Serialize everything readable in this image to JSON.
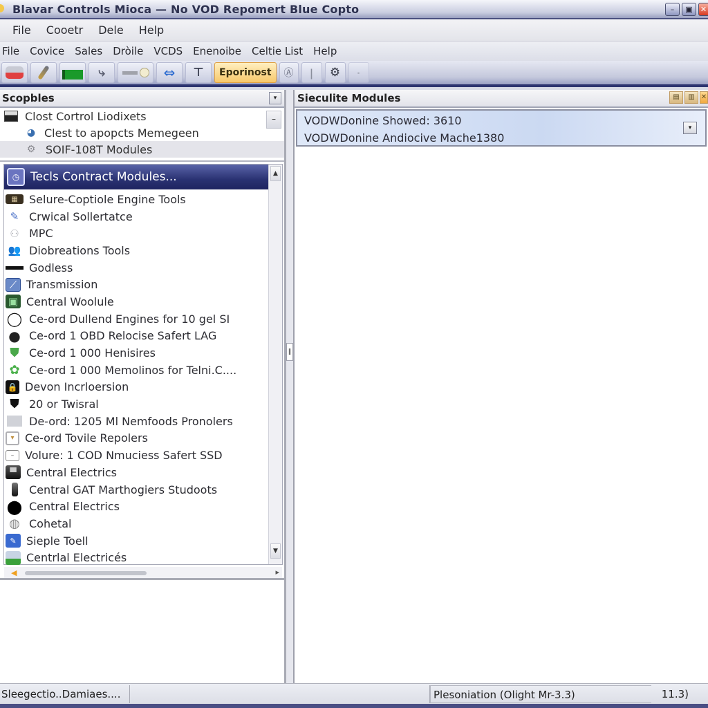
{
  "window": {
    "title": "Blavar Controls Mioca — No VOD Repomert Blue Copto",
    "controls": {
      "minimize": "–",
      "maximize": "▣",
      "close": "✕"
    }
  },
  "menubar_primary": [
    {
      "label": "File",
      "icon": null
    },
    {
      "label": "Cooetr"
    },
    {
      "label": "Dele"
    },
    {
      "label": "Help"
    }
  ],
  "menubar_secondary": [
    {
      "label": "File"
    },
    {
      "label": "Covice"
    },
    {
      "label": "Sales"
    },
    {
      "label": "Dròile"
    },
    {
      "label": "VCDS"
    },
    {
      "label": "Enenoibe"
    },
    {
      "label": "Celtie List"
    },
    {
      "label": "Help"
    }
  ],
  "toolbar": {
    "buttons": [
      {
        "icon": "connect-icon",
        "glyph": "🔌"
      },
      {
        "icon": "probe-icon",
        "glyph": "🖊"
      },
      {
        "icon": "battery-icon",
        "glyph": "▬"
      },
      {
        "icon": "wrench-icon",
        "glyph": "ℹ"
      },
      {
        "icon": "cable-icon",
        "glyph": "⊸"
      },
      {
        "icon": "transfer-icon",
        "glyph": "⇄"
      },
      {
        "icon": "filter-icon",
        "glyph": "⊤"
      },
      {
        "icon": "text-button",
        "label": "Eporinost",
        "active": true
      },
      {
        "icon": "help-icon",
        "glyph": "ⓐ"
      },
      {
        "icon": "info-icon",
        "glyph": "ℹ"
      },
      {
        "icon": "settings-icon",
        "glyph": "⚙"
      },
      {
        "icon": "disabled-icon",
        "glyph": "•"
      }
    ]
  },
  "left_pane": {
    "header": "Scopbles",
    "top_tree": [
      {
        "label": "Clost Cortrol Liodixets",
        "icon": "monitor-icon"
      },
      {
        "label": "Clest to apopcts Memegeen",
        "icon": "globe-icon"
      },
      {
        "label": "SOIF-108T Modules",
        "icon": "gear-icon"
      }
    ],
    "list_header": "Tecls Contract Modules...",
    "items": [
      {
        "label": "Selure-Coptiole Engine Tools",
        "icon": "engine-icon"
      },
      {
        "label": "Crwical Sollertatce",
        "icon": "pen-icon"
      },
      {
        "label": "MPC",
        "icon": "users-icon"
      },
      {
        "label": "Diobreations Tools",
        "icon": "folder-user-icon"
      },
      {
        "label": "Godless",
        "icon": "bar-icon"
      },
      {
        "label": "Transmission",
        "icon": "transmission-icon"
      },
      {
        "label": "Central Woolule",
        "icon": "module-icon"
      },
      {
        "label": "Ce-ord Dullend Engines for 10 gel SI",
        "icon": "ring-icon"
      },
      {
        "label": "Ce-ord 1 OBD Relocise Safert LAG",
        "icon": "disc-icon"
      },
      {
        "label": "Ce-ord 1 000 Henisires",
        "icon": "shield-green-icon"
      },
      {
        "label": "Ce-ord 1 000 Memolinos for Telni.C....",
        "icon": "gear-green-icon"
      },
      {
        "label": "Devon Incrloersion",
        "icon": "lock-icon"
      },
      {
        "label": "20 or Twisral",
        "icon": "shield-black-icon"
      },
      {
        "label": "De-ord: 1205 Ml Nemfoods Pronolers",
        "icon": "card-icon"
      },
      {
        "label": "Ce-ord Tovile Repolers",
        "icon": "badge-icon"
      },
      {
        "label": "Volure: 1 COD Nmuciess Safert SSD",
        "icon": "tv-icon"
      },
      {
        "label": "Central Electrics",
        "icon": "car-icon"
      },
      {
        "label": "Central GAT Marthogiers Studoots",
        "icon": "device-icon"
      },
      {
        "label": "Central Electrics",
        "icon": "circle-dark-icon"
      },
      {
        "label": "Cohetal",
        "icon": "globe-grey-icon"
      },
      {
        "label": "Sieple Toell",
        "icon": "window-blue-icon"
      },
      {
        "label": "Centrlal Electricés",
        "icon": "landscape-icon"
      }
    ]
  },
  "right_pane": {
    "header": "Sieculite Modules",
    "device_lines": [
      "VODWDonine Showed: 3610",
      "VODWDonine Andiocive Mache1380"
    ]
  },
  "statusbar": {
    "left": "Sleegectio..Damiaes....",
    "middle": "",
    "right": "Plesoniation (Olight Mr-3.3)",
    "far_right": "11.3)"
  }
}
